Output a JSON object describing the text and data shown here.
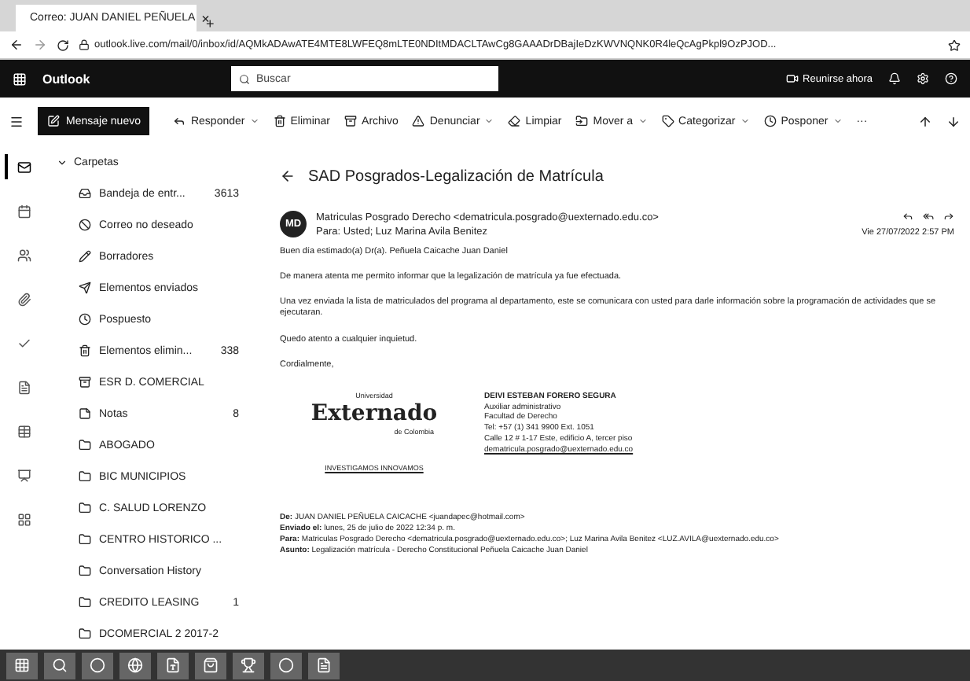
{
  "browser": {
    "tab": {
      "title": "Correo: JUAN DANIEL PEÑUELA",
      "close": "×",
      "new": "+"
    },
    "url": "outlook.live.com/mail/0/inbox/id/AQMkADAwATE4MTE8LWFEQ8mLTE0NDItMDACLTAwCg8GAAADrDBajIeDzKWVNQNK0R4leQcAgPkpl9OzPJOD..."
  },
  "header": {
    "app": "Outlook",
    "search_placeholder": "Buscar",
    "meet": "Reunirse ahora"
  },
  "toolbar": {
    "new_message": "Mensaje nuevo",
    "actions": [
      {
        "label": "Responder",
        "dropdown": true
      },
      {
        "label": "Eliminar",
        "dropdown": false
      },
      {
        "label": "Archivo",
        "dropdown": false
      },
      {
        "label": "Denunciar",
        "dropdown": true
      },
      {
        "label": "Limpiar",
        "dropdown": false
      },
      {
        "label": "Mover a",
        "dropdown": true
      },
      {
        "label": "Categorizar",
        "dropdown": true
      },
      {
        "label": "Posponer",
        "dropdown": true
      }
    ],
    "more": "···"
  },
  "rail": [
    {
      "kind": "mail",
      "selected": true
    },
    {
      "kind": "calendar",
      "selected": false
    },
    {
      "kind": "people",
      "selected": false
    },
    {
      "kind": "attach",
      "selected": false
    },
    {
      "kind": "todo",
      "selected": false
    },
    {
      "kind": "word",
      "selected": false
    },
    {
      "kind": "excel",
      "selected": false
    },
    {
      "kind": "powerpoint",
      "selected": false
    },
    {
      "kind": "apps",
      "selected": false
    }
  ],
  "folders": {
    "title": "Carpetas",
    "items": [
      {
        "kind": "inbox",
        "label": "Bandeja de entr...",
        "count": "3613"
      },
      {
        "kind": "junk",
        "label": "Correo no deseado"
      },
      {
        "kind": "drafts",
        "label": "Borradores"
      },
      {
        "kind": "sent",
        "label": "Elementos enviados"
      },
      {
        "kind": "snoozed",
        "label": "Pospuesto"
      },
      {
        "kind": "deleted",
        "label": "Elementos elimin...",
        "count": "338"
      },
      {
        "kind": "archive",
        "label": "ESR D. COMERCIAL"
      },
      {
        "kind": "notes",
        "label": "Notas",
        "count": "8"
      },
      {
        "kind": "folder",
        "label": "ABOGADO"
      },
      {
        "kind": "folder",
        "label": "BIC MUNICIPIOS"
      },
      {
        "kind": "folder",
        "label": "C. SALUD LORENZO"
      },
      {
        "kind": "folder",
        "label": "CENTRO HISTORICO ..."
      },
      {
        "kind": "folder",
        "label": "Conversation History"
      },
      {
        "kind": "folder",
        "label": "CREDITO LEASING",
        "count": "1"
      },
      {
        "kind": "folder",
        "label": "DCOMERCIAL 2 2017-2"
      }
    ]
  },
  "message": {
    "subject": "SAD Posgrados-Legalización de Matrícula",
    "avatar": "MD",
    "from": "Matriculas Posgrado Derecho <dematricula.posgrado@uexternado.edu.co>",
    "to": "Para: Usted;  Luz Marina Avila Benitez",
    "date": "Vie 27/07/2022 2:57 PM",
    "body": [
      "Buen día estimado(a) Dr(a). Peñuela Caicache Juan Daniel",
      "De manera atenta me permito informar que la legalización de matrícula ya fue efectuada.",
      "Una vez enviada la lista de matriculados del programa al departamento, este se comunicara con usted para darle información sobre la programación de actividades que se ejecutaran.",
      "Quedo atento a cualquier inquietud.",
      "Cordialmente,"
    ],
    "logo": {
      "top": "Universidad",
      "name": "Externado",
      "sub": "de Colombia",
      "tag": "INVESTIGAMOS INNOVAMOS"
    },
    "signature": {
      "name": "DEIVI ESTEBAN FORERO SEGURA",
      "lines": [
        "Auxiliar administrativo",
        "Facultad de Derecho",
        "Tel: +57 (1) 341 9900 Ext. 1051",
        "Calle 12 # 1-17 Este, edificio A, tercer piso"
      ],
      "link": "dematricula.posgrado@uexternado.edu.co"
    },
    "forwarded": [
      {
        "label": "De:",
        "value": "JUAN DANIEL PEÑUELA CAICACHE <juandapec@hotmail.com>"
      },
      {
        "label": "Enviado el:",
        "value": "lunes, 25 de julio de 2022 12:34 p. m."
      },
      {
        "label": "Para:",
        "value": "Matriculas Posgrado Derecho <dematricula.posgrado@uexternado.edu.co>; Luz Marina Avila Benitez <LUZ.AVILA@uexternado.edu.co>"
      },
      {
        "label": "Asunto:",
        "value": "Legalización matrícula - Derecho Constitucional Peñuela Caicache Juan Daniel"
      }
    ]
  },
  "taskbar": [
    {
      "kind": "windows"
    },
    {
      "kind": "search"
    },
    {
      "kind": "cortana"
    },
    {
      "kind": "edge"
    },
    {
      "kind": "skype"
    },
    {
      "kind": "store"
    },
    {
      "kind": "trophy"
    },
    {
      "kind": "chrome"
    },
    {
      "kind": "word"
    }
  ]
}
